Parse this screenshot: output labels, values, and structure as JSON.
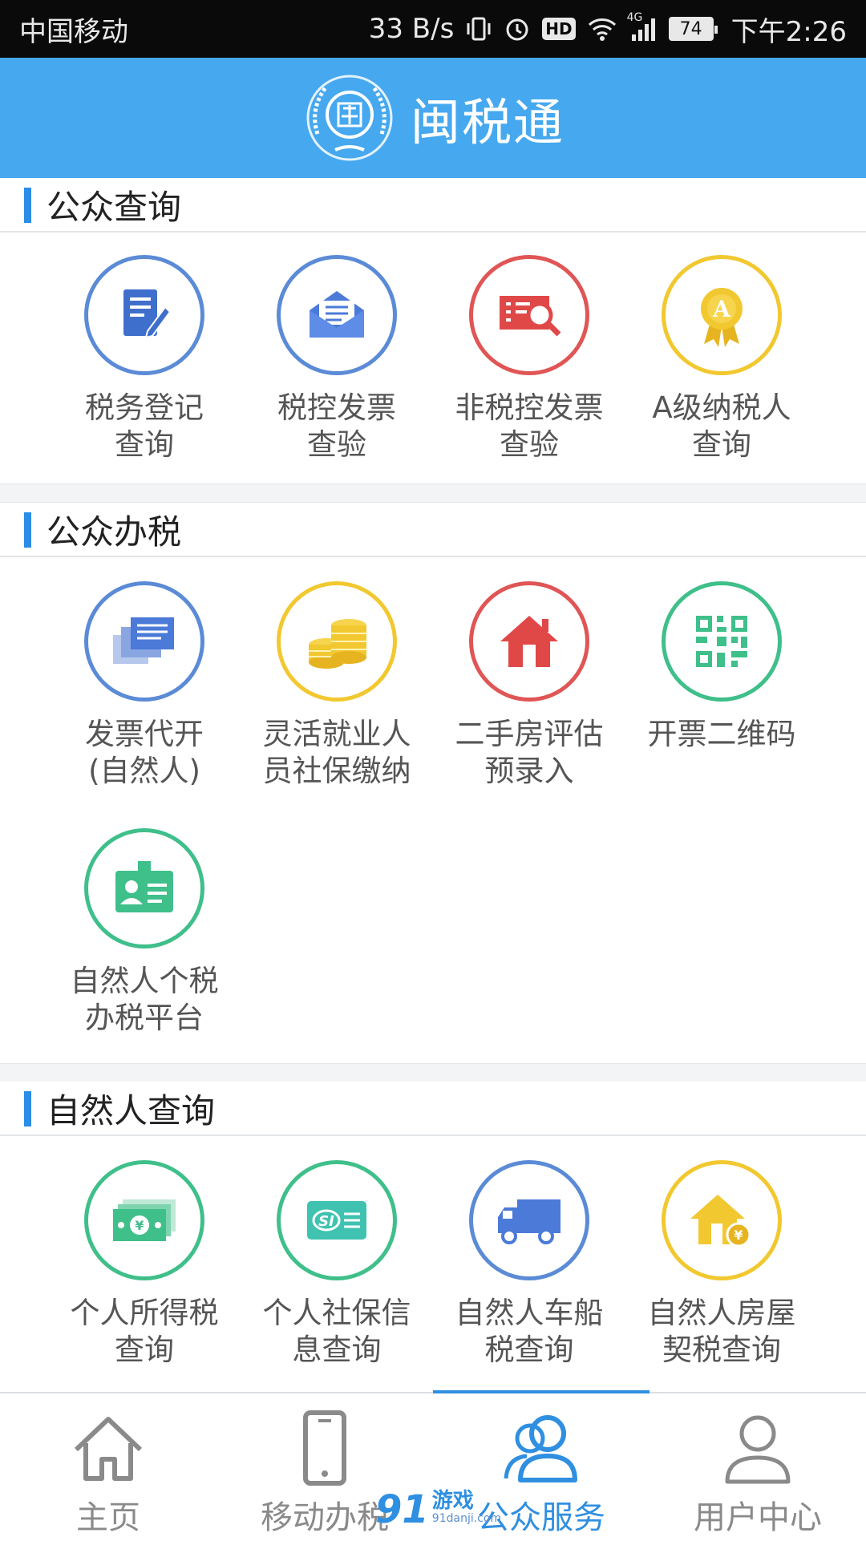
{
  "status_bar": {
    "carrier": "中国移动",
    "speed": "33 B/s",
    "hd": "HD",
    "network": "4G",
    "battery": "74",
    "time": "下午2:26"
  },
  "header": {
    "title": "闽税通"
  },
  "sections": [
    {
      "title": "公众查询",
      "items": [
        {
          "label": "税务登记\n查询",
          "icon": "tax-registration-icon",
          "color": "#5b8bd6"
        },
        {
          "label": "税控发票\n查验",
          "icon": "envelope-invoice-icon",
          "color": "#5b8bd6"
        },
        {
          "label": "非税控发票\n查验",
          "icon": "invoice-search-icon",
          "color": "#e05555"
        },
        {
          "label": "A级纳税人\n查询",
          "icon": "a-grade-medal-icon",
          "color": "#f2c830"
        }
      ]
    },
    {
      "title": "公众办税",
      "items": [
        {
          "label": "发票代开\n(自然人)",
          "icon": "invoice-stack-icon",
          "color": "#5b8bd6"
        },
        {
          "label": "灵活就业人\n员社保缴纳",
          "icon": "coins-icon",
          "color": "#f2c830"
        },
        {
          "label": "二手房评估\n预录入",
          "icon": "house-icon",
          "color": "#e05555"
        },
        {
          "label": "开票二维码",
          "icon": "qr-code-icon",
          "color": "#3fbf8a"
        },
        {
          "label": "自然人个税\n办税平台",
          "icon": "id-badge-icon",
          "color": "#3fbf8a"
        }
      ]
    },
    {
      "title": "自然人查询",
      "items": [
        {
          "label": "个人所得税\n查询",
          "icon": "money-icon",
          "color": "#3fbf8a"
        },
        {
          "label": "个人社保信\n息查询",
          "icon": "social-security-card-icon",
          "color": "#3fbf8a"
        },
        {
          "label": "自然人车船\n税查询",
          "icon": "truck-icon",
          "color": "#5b8bd6"
        },
        {
          "label": "自然人房屋\n契税查询",
          "icon": "house-coin-icon",
          "color": "#f2c830"
        }
      ]
    }
  ],
  "bottom_nav": [
    {
      "label": "主页",
      "icon": "home-icon",
      "active": false
    },
    {
      "label": "移动办税",
      "icon": "phone-icon",
      "active": false
    },
    {
      "label": "公众服务",
      "icon": "users-icon",
      "active": true
    },
    {
      "label": "用户中心",
      "icon": "user-icon",
      "active": false
    }
  ],
  "watermark": {
    "num": "91",
    "cn": "游戏",
    "en": "91danji.com"
  },
  "colors": {
    "accent": "#46a8ef",
    "active": "#2f8fe0"
  }
}
